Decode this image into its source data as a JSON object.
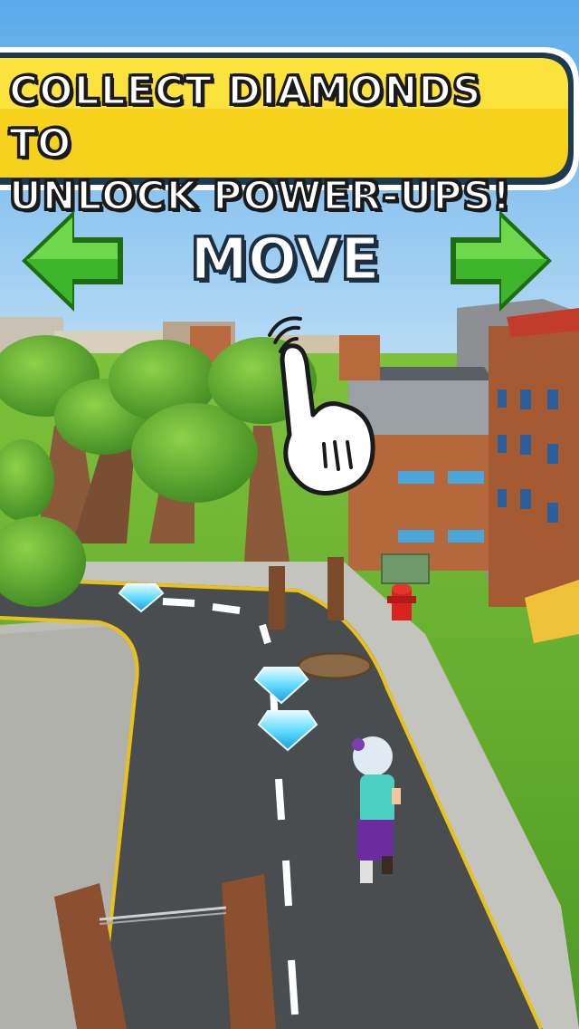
{
  "hud": {
    "banner_text": "COLLECT DIAMONDS TO\nUNLOCK POWER-UPS!",
    "move_label": "MOVE"
  },
  "icons": {
    "left": "left-arrow-icon",
    "right": "right-arrow-icon",
    "hand": "pointing-hand-icon"
  },
  "colors": {
    "banner_yellow": "#f6d21c",
    "arrow_green": "#38b02c",
    "sky": "#7bbff0",
    "grass": "#5fae2f",
    "road": "#4a4d50",
    "diamond": "#6fe3ff"
  }
}
